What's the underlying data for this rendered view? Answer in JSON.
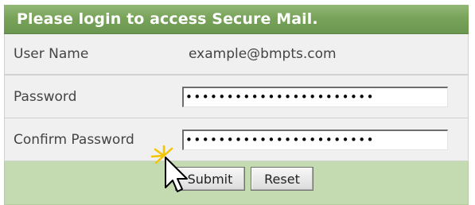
{
  "login": {
    "title": "Please login to access Secure Mail.",
    "username": {
      "label": "User Name",
      "value": "example@bmpts.com"
    },
    "password": {
      "label": "Password",
      "value": "•••••••••••••••••••••••"
    },
    "confirm_password": {
      "label": "Confirm Password",
      "value": "•••••••••••••••••••••••"
    },
    "buttons": {
      "submit": "Submit",
      "reset": "Reset"
    }
  },
  "colors": {
    "header_green": "#79a35a",
    "footer_green": "#c4dbb1",
    "row_background": "#f0f0f0",
    "click_highlight": "#f5c400"
  },
  "icons": {
    "cursor": "arrow-pointer-click-icon"
  }
}
